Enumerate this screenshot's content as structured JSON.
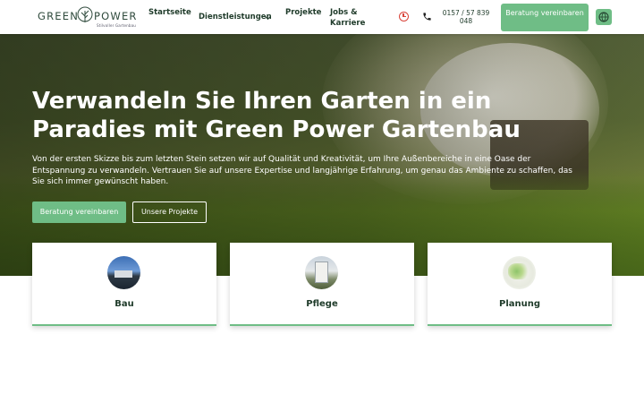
{
  "header": {
    "logo": {
      "left_word": "GREEN",
      "right_word": "POWER",
      "tagline": "Stilvoller Gartenbau"
    },
    "nav": {
      "home": "Startseite",
      "services": "Dienstleistungen",
      "projects": "Projekte",
      "jobs": "Jobs & Karriere"
    },
    "phone": "0157 / 57 839 048",
    "cta": "Beratung vereinbaren",
    "icons": {
      "clock": "clock-icon",
      "phone": "phone-icon",
      "language": "globe-icon",
      "dropdown": "chevron-down-icon"
    }
  },
  "hero": {
    "title": "Verwandeln Sie Ihren Garten in ein Paradies mit Green Power Gartenbau",
    "text": "Von der ersten Skizze bis zum letzten Stein setzen wir auf Qualität und Kreativität, um Ihre Außenbereiche in eine Oase der Entspannung zu verwandeln. Vertrauen Sie auf unsere Expertise und langjährige Erfahrung, um genau das Ambiente zu schaffen, das Sie sich immer gewünscht haben.",
    "primary_button": "Beratung vereinbaren",
    "secondary_button": "Unsere Projekte"
  },
  "services": [
    {
      "title": "Bau"
    },
    {
      "title": "Pflege"
    },
    {
      "title": "Planung"
    }
  ],
  "colors": {
    "accent": "#6fbd86",
    "dark_text": "#1f3b2a",
    "clock_icon": "#d9443a"
  }
}
